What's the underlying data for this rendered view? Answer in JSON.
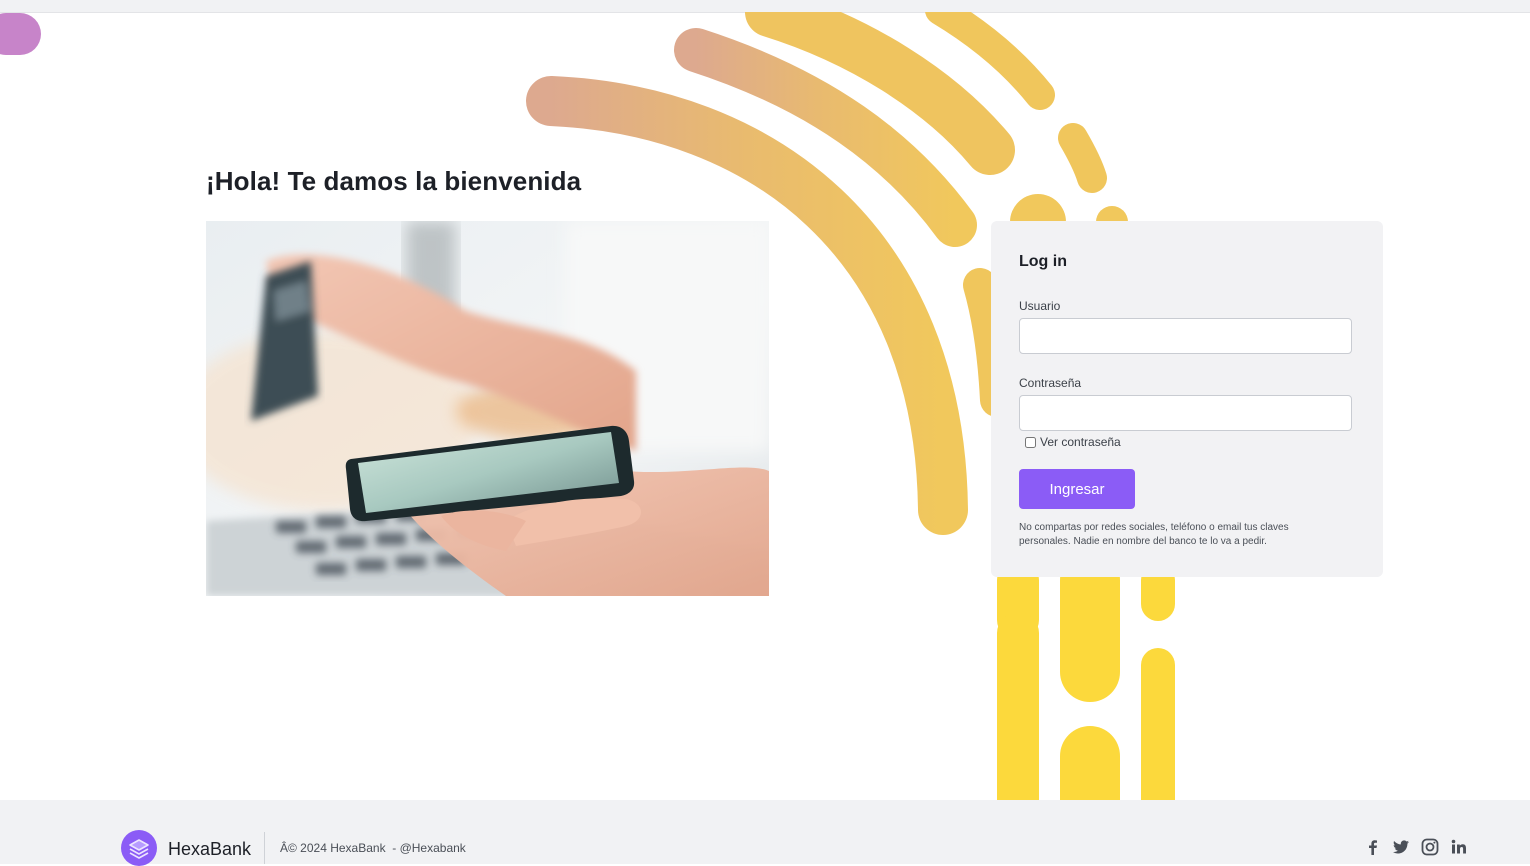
{
  "page": {
    "welcome_title": "¡Hola! Te damos la bienvenida"
  },
  "hero": {
    "image": "person holding smartphone and credit card over laptop keyboard"
  },
  "login": {
    "title": "Log in",
    "user_label": "Usuario",
    "user_value": "",
    "password_label": "Contraseña",
    "password_value": "",
    "show_password_label": "Ver contraseña",
    "show_password_checked": false,
    "submit_label": "Ingresar",
    "disclaimer": "No compartas por redes sociales, teléfono o email tus claves personales. Nadie en nombre del banco te lo va a pedir."
  },
  "footer": {
    "brand": "HexaBank",
    "copyright": "Â© 2024 HexaBank  - @Hexabank",
    "social": [
      "facebook-icon",
      "twitter-icon",
      "instagram-icon",
      "linkedin-icon"
    ]
  },
  "colors": {
    "accent": "#8b5cf6",
    "deco_purple": "#b877d6",
    "deco_peach": "#e0ae8b",
    "deco_yellow": "#f0c75a",
    "deco_bright_yellow": "#fcd93c",
    "card_bg": "#f2f2f4",
    "footer_bg": "#f1f2f4"
  }
}
